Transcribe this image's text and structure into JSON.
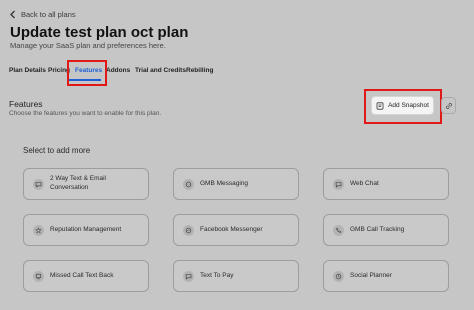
{
  "header": {
    "back_label": "Back to all plans",
    "title": "Update test plan oct plan",
    "subtitle": "Manage your SaaS plan and preferences here."
  },
  "tabs": [
    {
      "label": "Plan Details",
      "active": false
    },
    {
      "label": "Pricing",
      "active": false
    },
    {
      "label": "Features",
      "active": true
    },
    {
      "label": "Addons",
      "active": false
    },
    {
      "label": "Trial and Credits",
      "active": false
    },
    {
      "label": "Rebilling",
      "active": false
    }
  ],
  "features_section": {
    "title": "Features",
    "description": "Choose the features you want to enable for this plan.",
    "add_snapshot_label": "Add Snapshot",
    "select_title": "Select to add more"
  },
  "cards": [
    {
      "label": "2 Way Text & Email Conversation",
      "icon": "chat-bubble-icon"
    },
    {
      "label": "GMB Messaging",
      "icon": "message-icon"
    },
    {
      "label": "Web Chat",
      "icon": "web-chat-icon"
    },
    {
      "label": "Reputation Management",
      "icon": "star-icon"
    },
    {
      "label": "Facebook Messenger",
      "icon": "messenger-icon"
    },
    {
      "label": "GMB Call Tracking",
      "icon": "phone-icon"
    },
    {
      "label": "Missed Call Text Back",
      "icon": "missed-call-icon"
    },
    {
      "label": "Text To Pay",
      "icon": "payment-icon"
    },
    {
      "label": "Social Planner",
      "icon": "calendar-icon"
    }
  ],
  "colors": {
    "accent": "#1e5fd6",
    "highlight": "#e01818",
    "background": "#c6c6c6"
  }
}
